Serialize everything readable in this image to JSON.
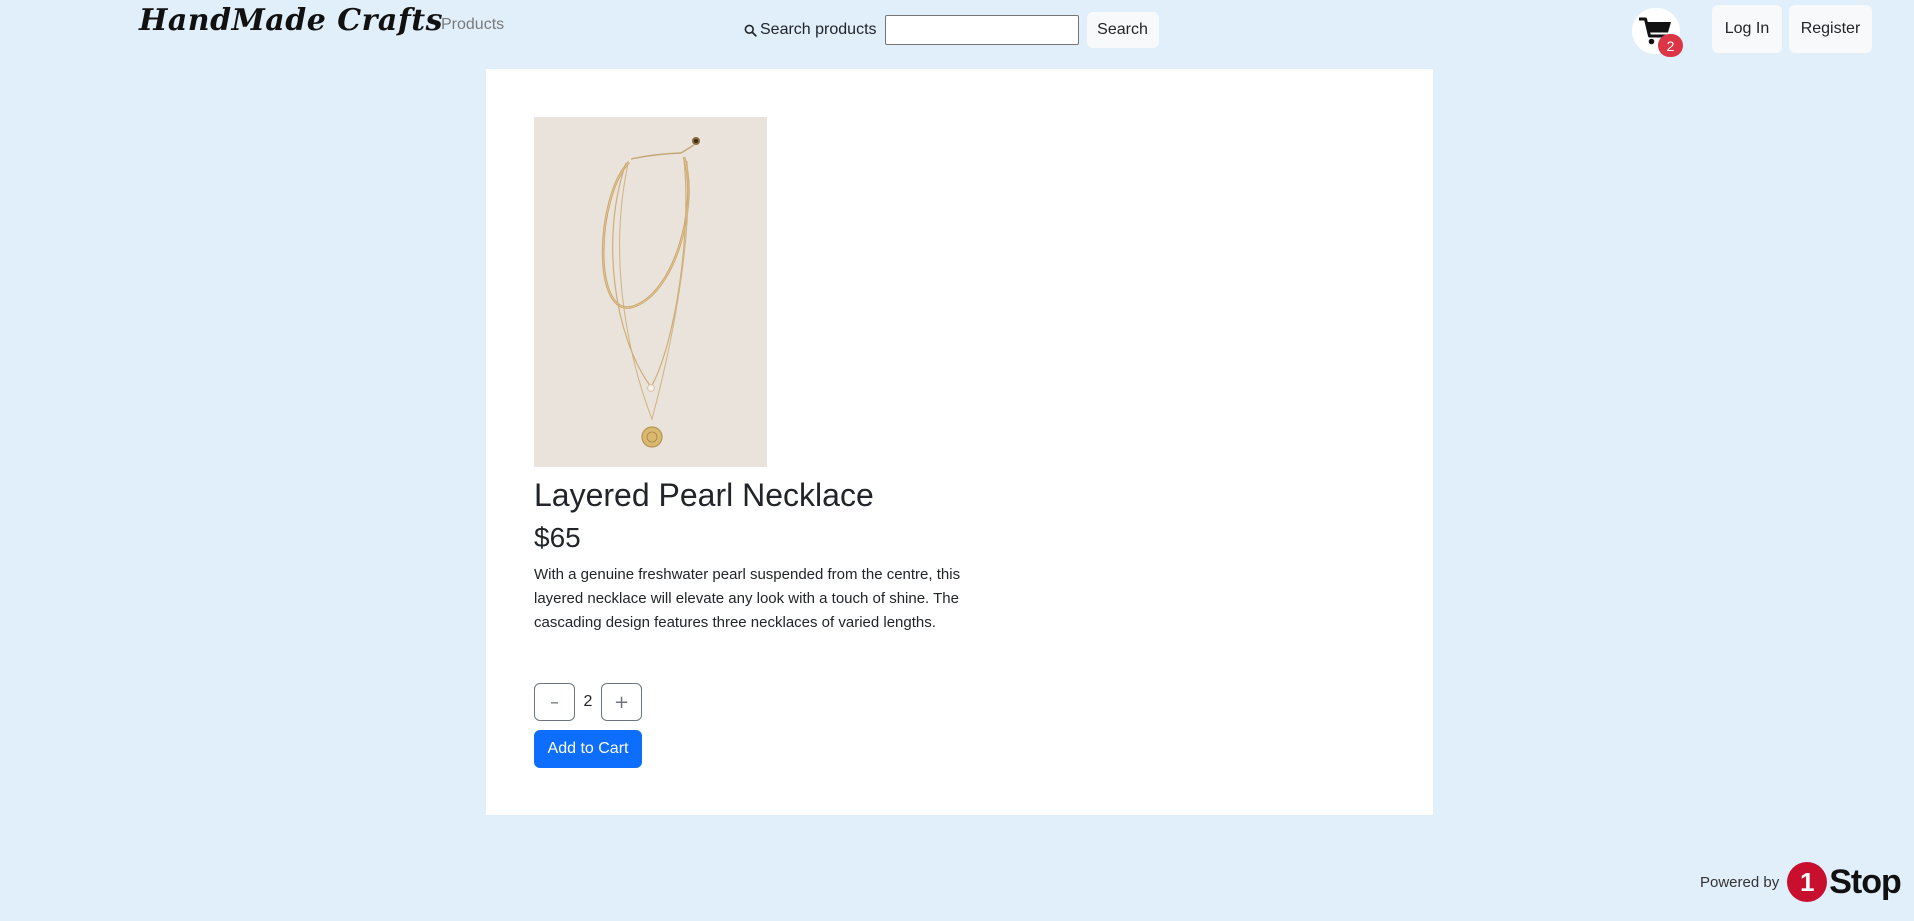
{
  "header": {
    "brand": "HandMade Crafts",
    "nav_products": "Products",
    "search": {
      "label": "Search products",
      "value": "",
      "placeholder": "",
      "button": "Search"
    },
    "cart": {
      "icon": "cart-icon",
      "badge_count": "2"
    },
    "login": "Log In",
    "register": "Register"
  },
  "product": {
    "image_icon": "layered-necklace-photo",
    "title": "Layered Pearl Necklace",
    "price": "$65",
    "description": "With a genuine freshwater pearl suspended from the centre, this layered necklace will elevate any look with a touch of shine. The cascading design features three necklaces of varied lengths.",
    "quantity": "2",
    "decrement_symbol": "–",
    "increment_symbol": "+",
    "add_to_cart": "Add to Cart"
  },
  "footer": {
    "powered_by": "Powered by",
    "logo_number": "1",
    "logo_word": "Stop"
  },
  "colors": {
    "page_background": "#e1effb",
    "card_background": "#ffffff",
    "primary_button": "#0d6efd",
    "badge": "#dc3545",
    "logo_red": "#c8102e"
  }
}
